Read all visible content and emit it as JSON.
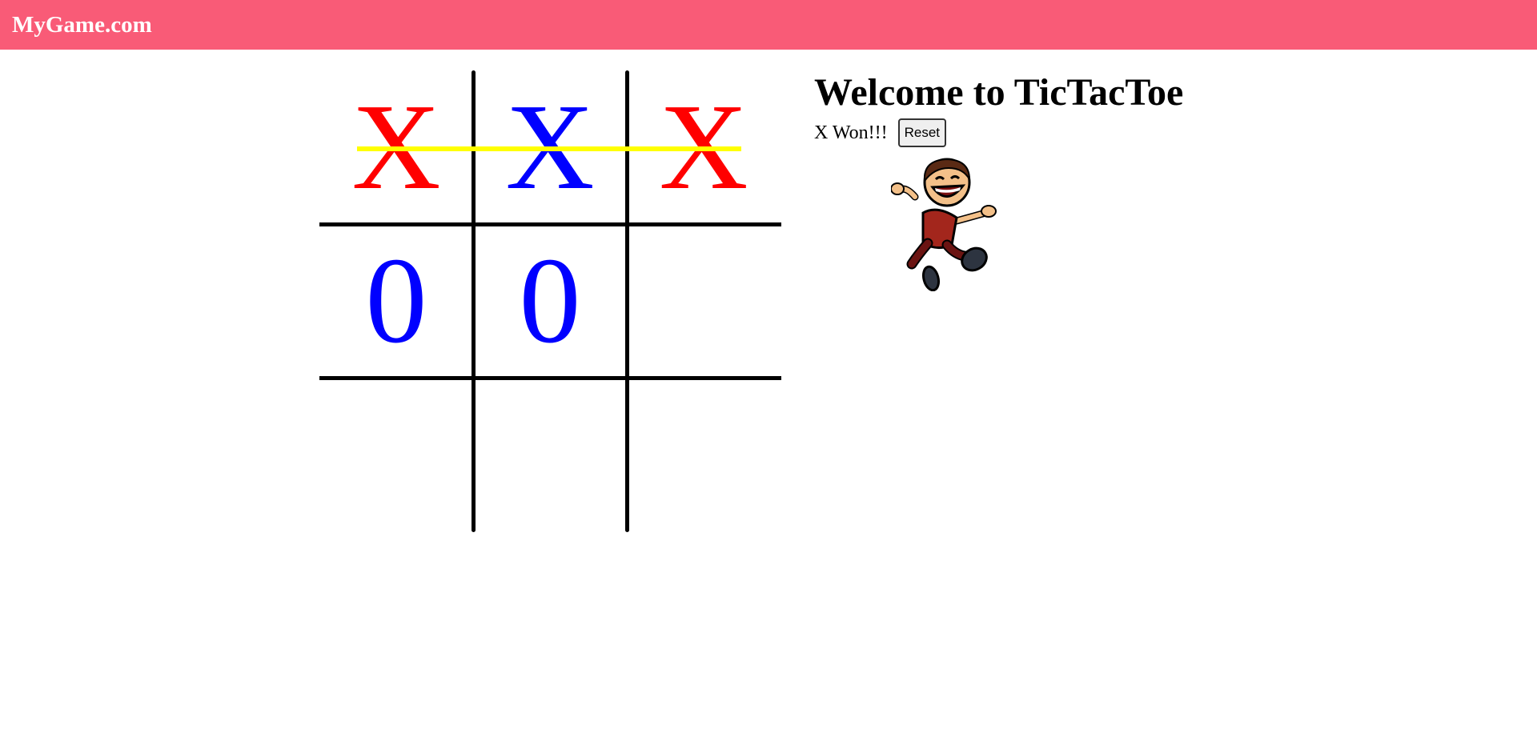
{
  "navbar": {
    "brand": "MyGame.com",
    "color": "#f95b77"
  },
  "game": {
    "title": "Welcome to TicTacToe",
    "status": "X Won!!!",
    "reset_label": "Reset",
    "winning_line": "row-1",
    "winning_line_color": "#ffff00",
    "cells": [
      {
        "value": "X",
        "color": "#ff0000"
      },
      {
        "value": "X",
        "color": "#0000ff"
      },
      {
        "value": "X",
        "color": "#ff0000"
      },
      {
        "value": "0",
        "color": "#0000ff"
      },
      {
        "value": "0",
        "color": "#0000ff"
      },
      {
        "value": "",
        "color": ""
      },
      {
        "value": "",
        "color": ""
      },
      {
        "value": "",
        "color": ""
      },
      {
        "value": "",
        "color": ""
      }
    ],
    "celebration_image": "happy-jumping-cartoon-boy"
  }
}
